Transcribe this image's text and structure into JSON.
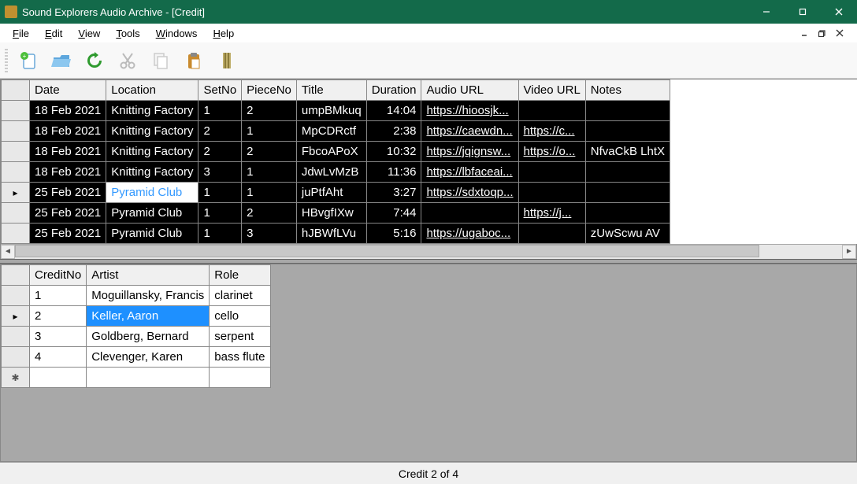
{
  "window": {
    "title": "Sound Explorers Audio Archive - [Credit]"
  },
  "menu": {
    "file": "File",
    "edit": "Edit",
    "view": "View",
    "tools": "Tools",
    "windows": "Windows",
    "help": "Help"
  },
  "top_grid": {
    "headers": {
      "date": "Date",
      "location": "Location",
      "setno": "SetNo",
      "pieceno": "PieceNo",
      "title": "Title",
      "duration": "Duration",
      "audio_url": "Audio URL",
      "video_url": "Video URL",
      "notes": "Notes"
    },
    "rows": [
      {
        "date": "18 Feb 2021",
        "location": "Knitting Factory",
        "setno": "1",
        "pieceno": "2",
        "title": "umpBMkuq",
        "duration": "14:04",
        "audio_url": "https://hioosjk...",
        "video_url": "",
        "notes": ""
      },
      {
        "date": "18 Feb 2021",
        "location": "Knitting Factory",
        "setno": "2",
        "pieceno": "1",
        "title": "MpCDRctf",
        "duration": "2:38",
        "audio_url": "https://caewdn...",
        "video_url": "https://c...",
        "notes": ""
      },
      {
        "date": "18 Feb 2021",
        "location": "Knitting Factory",
        "setno": "2",
        "pieceno": "2",
        "title": "FbcoAPoX",
        "duration": "10:32",
        "audio_url": "https://jqignsw...",
        "video_url": "https://o...",
        "notes": "NfvaCkB LhtX"
      },
      {
        "date": "18 Feb 2021",
        "location": "Knitting Factory",
        "setno": "3",
        "pieceno": "1",
        "title": "JdwLvMzB",
        "duration": "11:36",
        "audio_url": "https://lbfaceai...",
        "video_url": "",
        "notes": ""
      },
      {
        "date": "25 Feb 2021",
        "location": "Pyramid Club",
        "setno": "1",
        "pieceno": "1",
        "title": "juPtfAht",
        "duration": "3:27",
        "audio_url": "https://sdxtoqp...",
        "video_url": "",
        "notes": "",
        "active": true,
        "sel_field": "location"
      },
      {
        "date": "25 Feb 2021",
        "location": "Pyramid Club",
        "setno": "1",
        "pieceno": "2",
        "title": "HBvgfIXw",
        "duration": "7:44",
        "audio_url": "",
        "video_url": "https://j...",
        "notes": ""
      },
      {
        "date": "25 Feb 2021",
        "location": "Pyramid Club",
        "setno": "1",
        "pieceno": "3",
        "title": "hJBWfLVu",
        "duration": "5:16",
        "audio_url": "https://ugaboc...",
        "video_url": "",
        "notes": "zUwScwu AV"
      }
    ]
  },
  "bottom_grid": {
    "headers": {
      "creditno": "CreditNo",
      "artist": "Artist",
      "role": "Role"
    },
    "rows": [
      {
        "creditno": "1",
        "artist": "Moguillansky, Francis",
        "role": "clarinet"
      },
      {
        "creditno": "2",
        "artist": "Keller, Aaron",
        "role": "cello",
        "active": true,
        "sel_field": "artist"
      },
      {
        "creditno": "3",
        "artist": "Goldberg, Bernard",
        "role": "serpent"
      },
      {
        "creditno": "4",
        "artist": "Clevenger, Karen",
        "role": "bass flute"
      }
    ]
  },
  "status": {
    "text": "Credit 2 of 4"
  }
}
